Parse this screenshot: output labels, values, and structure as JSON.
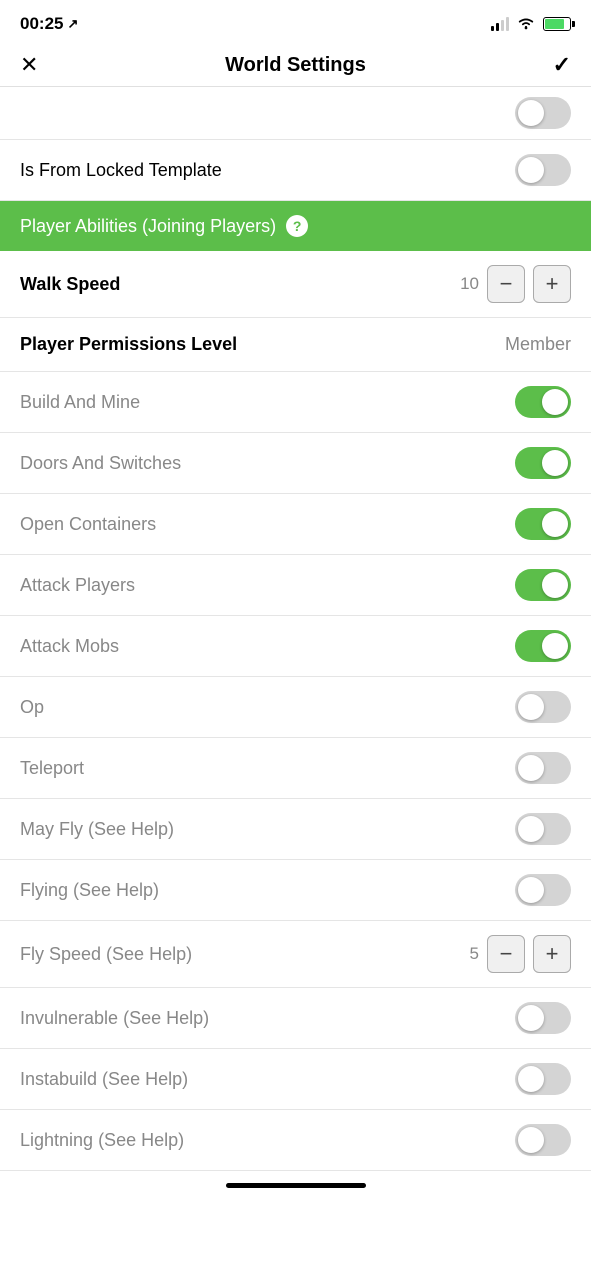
{
  "statusBar": {
    "time": "00:25",
    "locationIcon": "↗"
  },
  "navBar": {
    "closeLabel": "✕",
    "title": "World Settings",
    "checkLabel": "✓"
  },
  "partialToggle": {
    "state": "off"
  },
  "isFromLockedTemplate": {
    "label": "Is From Locked Template",
    "state": "off"
  },
  "playerAbilitiesSection": {
    "label": "Player Abilities (Joining Players)",
    "helpIcon": "?"
  },
  "walkSpeed": {
    "label": "Walk Speed",
    "value": "10"
  },
  "playerPermissions": {
    "label": "Player Permissions Level",
    "value": "Member"
  },
  "toggleRows": [
    {
      "label": "Build And Mine",
      "state": "on"
    },
    {
      "label": "Doors And Switches",
      "state": "on"
    },
    {
      "label": "Open Containers",
      "state": "on"
    },
    {
      "label": "Attack Players",
      "state": "on"
    },
    {
      "label": "Attack Mobs",
      "state": "on"
    },
    {
      "label": "Op",
      "state": "off"
    },
    {
      "label": "Teleport",
      "state": "off"
    },
    {
      "label": "May Fly (See Help)",
      "state": "off"
    },
    {
      "label": "Flying (See Help)",
      "state": "off"
    }
  ],
  "flySpeed": {
    "label": "Fly Speed (See Help)",
    "value": "5"
  },
  "toggleRowsBottom": [
    {
      "label": "Invulnerable (See Help)",
      "state": "off"
    },
    {
      "label": "Instabuild (See Help)",
      "state": "off"
    },
    {
      "label": "Lightning (See Help)",
      "state": "off"
    }
  ],
  "stepperMinus": "−",
  "stepperPlus": "+"
}
